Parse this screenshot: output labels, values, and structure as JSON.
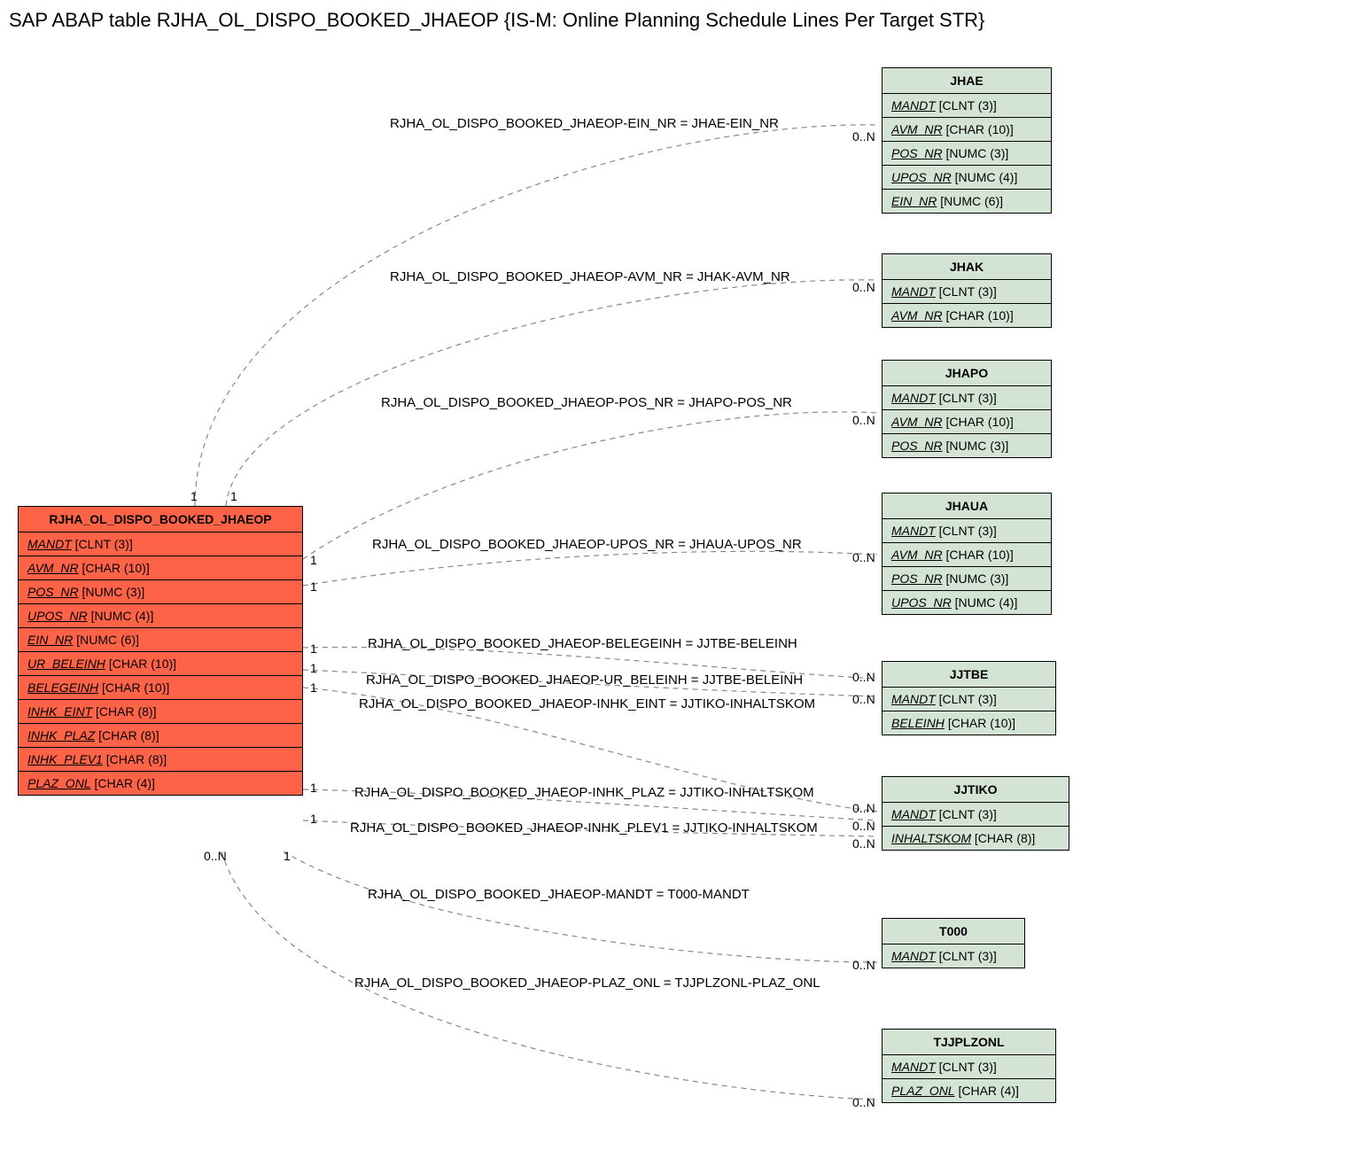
{
  "title": "SAP ABAP table RJHA_OL_DISPO_BOOKED_JHAEOP {IS-M: Online Planning Schedule Lines Per Target STR}",
  "main": {
    "name": "RJHA_OL_DISPO_BOOKED_JHAEOP",
    "fields": [
      {
        "name": "MANDT",
        "type": "[CLNT (3)]"
      },
      {
        "name": "AVM_NR",
        "type": "[CHAR (10)]"
      },
      {
        "name": "POS_NR",
        "type": "[NUMC (3)]"
      },
      {
        "name": "UPOS_NR",
        "type": "[NUMC (4)]"
      },
      {
        "name": "EIN_NR",
        "type": "[NUMC (6)]"
      },
      {
        "name": "UR_BELEINH",
        "type": "[CHAR (10)]"
      },
      {
        "name": "BELEGEINH",
        "type": "[CHAR (10)]"
      },
      {
        "name": "INHK_EINT",
        "type": "[CHAR (8)]"
      },
      {
        "name": "INHK_PLAZ",
        "type": "[CHAR (8)]"
      },
      {
        "name": "INHK_PLEV1",
        "type": "[CHAR (8)]"
      },
      {
        "name": "PLAZ_ONL",
        "type": "[CHAR (4)]"
      }
    ]
  },
  "refs": [
    {
      "name": "JHAE",
      "fields": [
        {
          "name": "MANDT",
          "type": "[CLNT (3)]"
        },
        {
          "name": "AVM_NR",
          "type": "[CHAR (10)]"
        },
        {
          "name": "POS_NR",
          "type": "[NUMC (3)]"
        },
        {
          "name": "UPOS_NR",
          "type": "[NUMC (4)]"
        },
        {
          "name": "EIN_NR",
          "type": "[NUMC (6)]"
        }
      ]
    },
    {
      "name": "JHAK",
      "fields": [
        {
          "name": "MANDT",
          "type": "[CLNT (3)]"
        },
        {
          "name": "AVM_NR",
          "type": "[CHAR (10)]"
        }
      ]
    },
    {
      "name": "JHAPO",
      "fields": [
        {
          "name": "MANDT",
          "type": "[CLNT (3)]"
        },
        {
          "name": "AVM_NR",
          "type": "[CHAR (10)]"
        },
        {
          "name": "POS_NR",
          "type": "[NUMC (3)]"
        }
      ]
    },
    {
      "name": "JHAUA",
      "fields": [
        {
          "name": "MANDT",
          "type": "[CLNT (3)]"
        },
        {
          "name": "AVM_NR",
          "type": "[CHAR (10)]"
        },
        {
          "name": "POS_NR",
          "type": "[NUMC (3)]"
        },
        {
          "name": "UPOS_NR",
          "type": "[NUMC (4)]"
        }
      ]
    },
    {
      "name": "JJTBE",
      "fields": [
        {
          "name": "MANDT",
          "type": "[CLNT (3)]"
        },
        {
          "name": "BELEINH",
          "type": "[CHAR (10)]"
        }
      ]
    },
    {
      "name": "JJTIKO",
      "fields": [
        {
          "name": "MANDT",
          "type": "[CLNT (3)]"
        },
        {
          "name": "INHALTSKOM",
          "type": "[CHAR (8)]"
        }
      ]
    },
    {
      "name": "T000",
      "fields": [
        {
          "name": "MANDT",
          "type": "[CLNT (3)]"
        }
      ]
    },
    {
      "name": "TJJPLZONL",
      "fields": [
        {
          "name": "MANDT",
          "type": "[CLNT (3)]"
        },
        {
          "name": "PLAZ_ONL",
          "type": "[CHAR (4)]"
        }
      ]
    }
  ],
  "rels": [
    {
      "label": "RJHA_OL_DISPO_BOOKED_JHAEOP-EIN_NR = JHAE-EIN_NR"
    },
    {
      "label": "RJHA_OL_DISPO_BOOKED_JHAEOP-AVM_NR = JHAK-AVM_NR"
    },
    {
      "label": "RJHA_OL_DISPO_BOOKED_JHAEOP-POS_NR = JHAPO-POS_NR"
    },
    {
      "label": "RJHA_OL_DISPO_BOOKED_JHAEOP-UPOS_NR = JHAUA-UPOS_NR"
    },
    {
      "label": "RJHA_OL_DISPO_BOOKED_JHAEOP-BELEGEINH = JJTBE-BELEINH"
    },
    {
      "label": "RJHA_OL_DISPO_BOOKED_JHAEOP-UR_BELEINH = JJTBE-BELEINH"
    },
    {
      "label": "RJHA_OL_DISPO_BOOKED_JHAEOP-INHK_EINT = JJTIKO-INHALTSKOM"
    },
    {
      "label": "RJHA_OL_DISPO_BOOKED_JHAEOP-INHK_PLAZ = JJTIKO-INHALTSKOM"
    },
    {
      "label": "RJHA_OL_DISPO_BOOKED_JHAEOP-INHK_PLEV1 = JJTIKO-INHALTSKOM"
    },
    {
      "label": "RJHA_OL_DISPO_BOOKED_JHAEOP-MANDT = T000-MANDT"
    },
    {
      "label": "RJHA_OL_DISPO_BOOKED_JHAEOP-PLAZ_ONL = TJJPLZONL-PLAZ_ONL"
    }
  ],
  "cards": {
    "one": "1",
    "zeroN": "0..N"
  }
}
